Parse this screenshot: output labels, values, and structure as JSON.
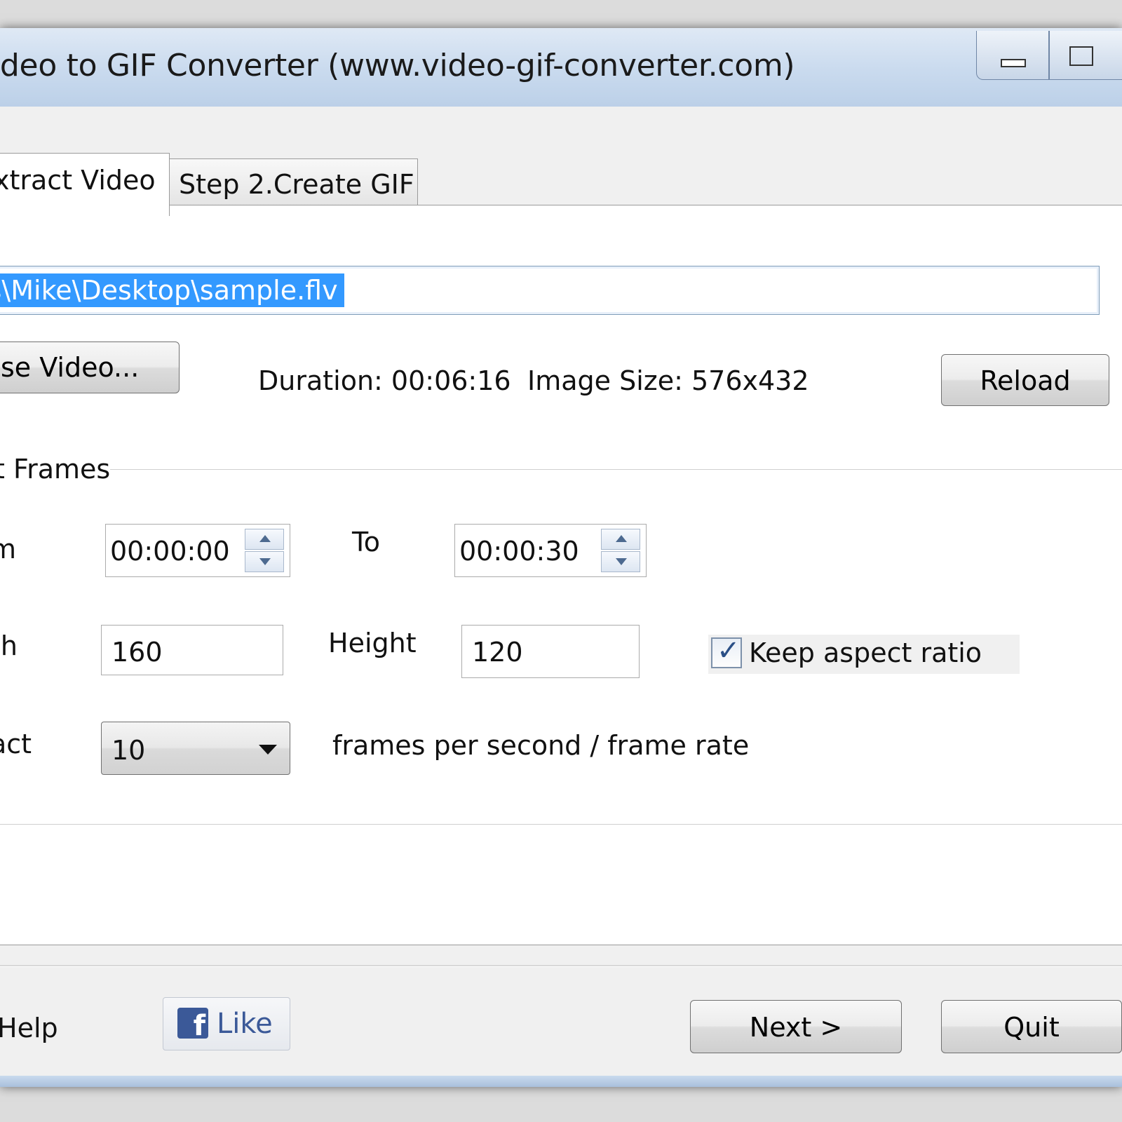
{
  "window": {
    "title": "ideo to GIF Converter (www.video-gif-converter.com)"
  },
  "tabs": [
    {
      "label": "xtract Video",
      "active": true
    },
    {
      "label": "Step 2.Create GIF",
      "active": false
    }
  ],
  "file": {
    "path": "rs\\Mike\\Desktop\\sample.flv",
    "browse_label": "se Video...",
    "duration": "Duration: 00:06:16",
    "image_size": "Image Size: 576x432",
    "reload_label": "Reload"
  },
  "frames": {
    "group_title": "t Frames",
    "from_label": "m",
    "from_value": "00:00:00",
    "to_label": "To",
    "to_value": "00:00:30",
    "width_label": "th",
    "width_value": "160",
    "height_label": "Height",
    "height_value": "120",
    "keep_aspect_label": "Keep aspect ratio",
    "keep_aspect_checked": true,
    "extract_label": "act",
    "fps_value": "10",
    "fps_suffix": "frames per second / frame rate"
  },
  "footer": {
    "help_label": "Help",
    "like_label": "Like",
    "next_label": "Next >",
    "quit_label": "Quit"
  },
  "colors": {
    "selection": "#3399ff",
    "facebook": "#3b5998"
  }
}
